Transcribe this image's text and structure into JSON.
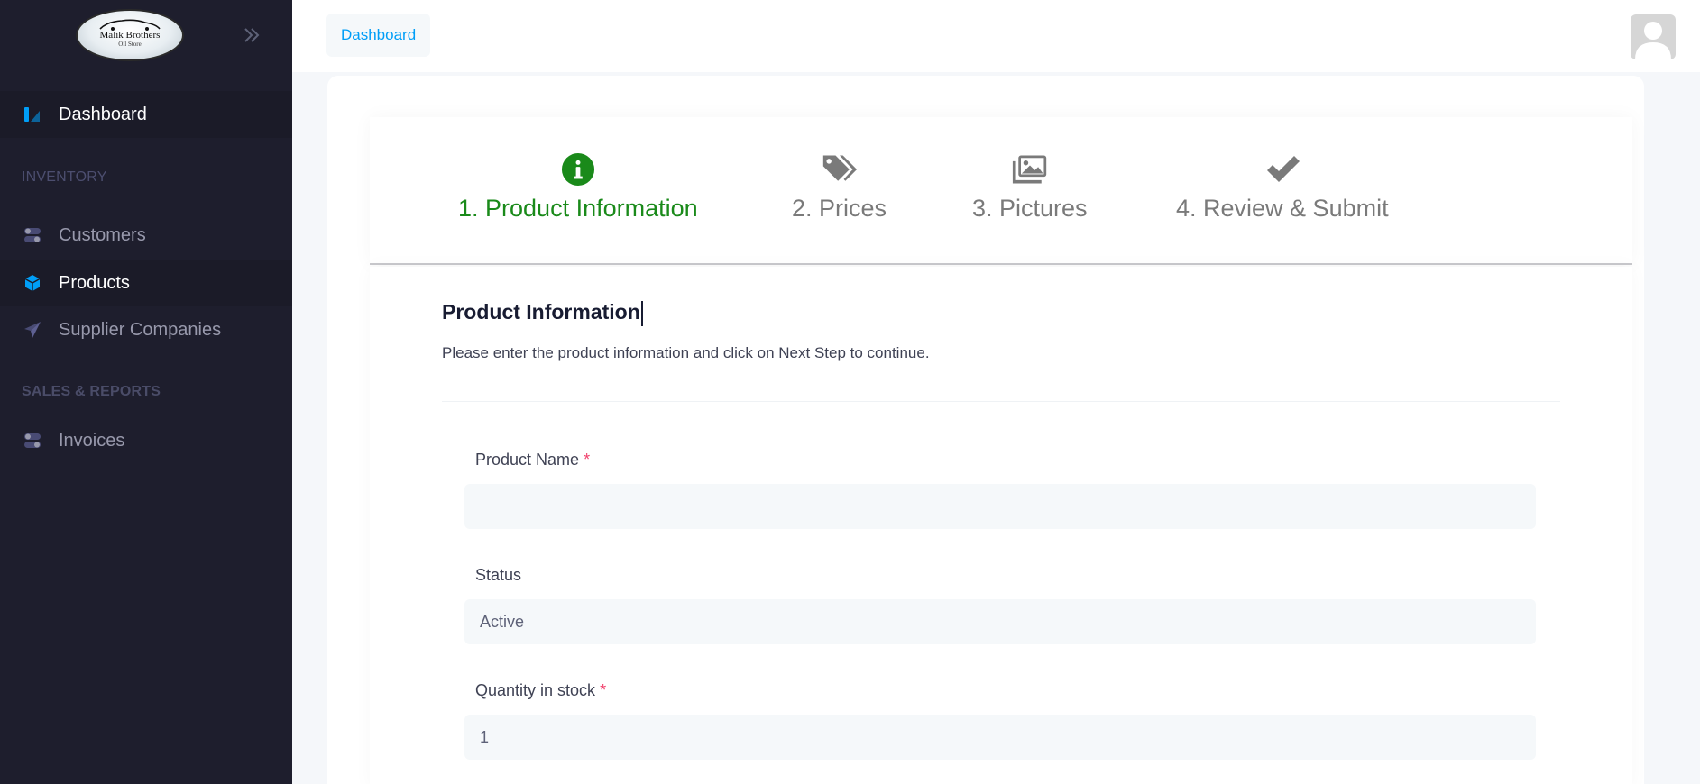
{
  "brand": {
    "logo_line1": "Malik Brothers",
    "logo_line2": "Oil Store"
  },
  "sidebar": {
    "dashboard_label": "Dashboard",
    "inventory_header": "INVENTORY",
    "customers_label": "Customers",
    "products_label": "Products",
    "suppliers_label": "Supplier Companies",
    "sales_header": "SALES & REPORTS",
    "invoices_label": "Invoices"
  },
  "topbar": {
    "breadcrumb": "Dashboard"
  },
  "stepper": {
    "steps": [
      {
        "label": "1. Product Information",
        "icon": "info-circle-icon",
        "current": true
      },
      {
        "label": "2. Prices",
        "icon": "tags-icon",
        "current": false
      },
      {
        "label": "3. Pictures",
        "icon": "images-icon",
        "current": false
      },
      {
        "label": "4. Review & Submit",
        "icon": "check-icon",
        "current": false
      }
    ]
  },
  "form": {
    "title": "Product Information",
    "description": "Please enter the product information and click on Next Step to continue.",
    "product_name_label": "Product Name",
    "product_name_value": "",
    "status_label": "Status",
    "status_value": "Active",
    "quantity_label": "Quantity in stock",
    "quantity_value": "1",
    "required_mark": "*"
  },
  "colors": {
    "sidebar_bg": "#1e1e2d",
    "accent": "#009ef7",
    "step_active": "#1a8a1a",
    "required": "#f1416c"
  }
}
